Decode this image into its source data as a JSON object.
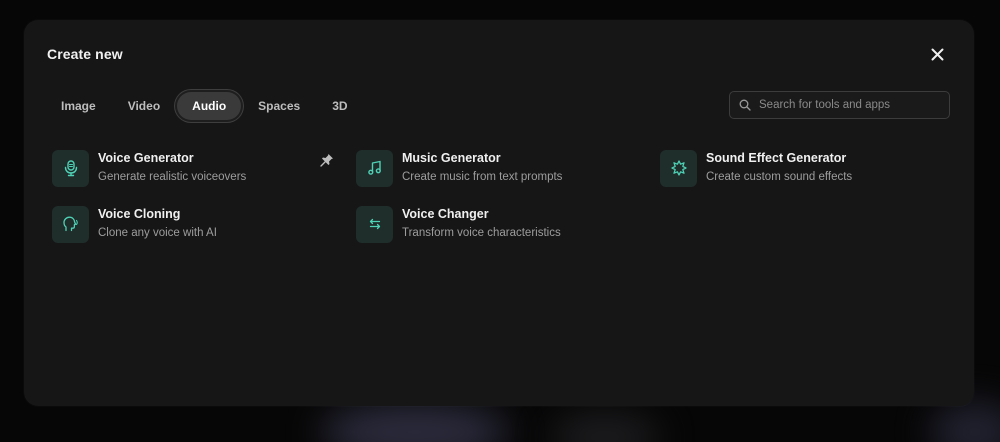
{
  "modal": {
    "title": "Create new"
  },
  "tabs": [
    {
      "label": "Image",
      "active": false
    },
    {
      "label": "Video",
      "active": false
    },
    {
      "label": "Audio",
      "active": true
    },
    {
      "label": "Spaces",
      "active": false
    },
    {
      "label": "3D",
      "active": false
    }
  ],
  "search": {
    "placeholder": "Search for tools and apps",
    "value": ""
  },
  "tools": [
    {
      "name": "Voice Generator",
      "description": "Generate realistic voiceovers",
      "icon": "microphone-icon",
      "pinned": true
    },
    {
      "name": "Music Generator",
      "description": "Create music from text prompts",
      "icon": "music-note-icon"
    },
    {
      "name": "Sound Effect Generator",
      "description": "Create custom sound effects",
      "icon": "burst-icon"
    },
    {
      "name": "Voice Cloning",
      "description": "Clone any voice with AI",
      "icon": "head-speaking-icon"
    },
    {
      "name": "Voice Changer",
      "description": "Transform voice characteristics",
      "icon": "swap-arrows-icon"
    }
  ],
  "colors": {
    "accent": "#4fd1b5",
    "icon_tile": "#1f2d2b",
    "modal_bg": "#161616",
    "active_tab": "#3a3a3a"
  }
}
